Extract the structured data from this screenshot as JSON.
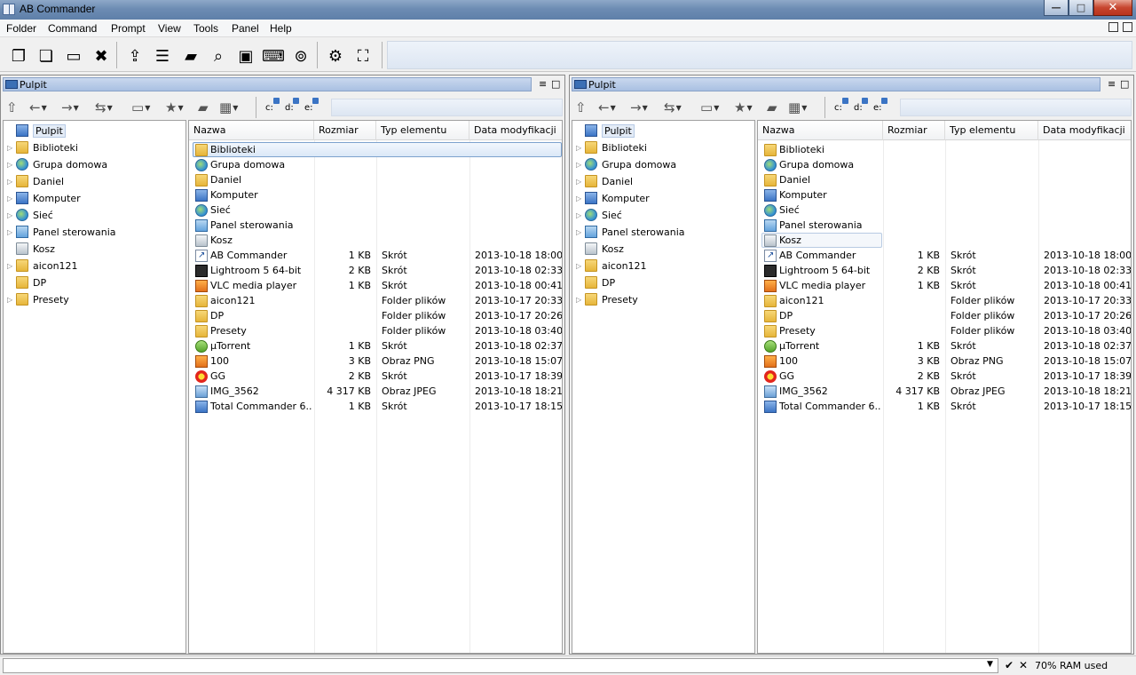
{
  "app": {
    "title": "AB Commander"
  },
  "window_controls": {
    "minimize": "—",
    "maximize": "□",
    "close": "✕"
  },
  "menu": [
    "Folder",
    "Command",
    "Prompt",
    "View",
    "Tools",
    "Panel",
    "Help"
  ],
  "toolbar": {
    "icons": [
      "copy-icon",
      "paste-icon",
      "rename-icon",
      "delete-icon",
      "move-icon",
      "notepad-icon",
      "new-folder-icon",
      "search-icon",
      "image-icon",
      "console-icon",
      "find-icon",
      "settings-icon",
      "fit-icon"
    ],
    "glyphs": [
      "❐",
      "❏",
      "▭",
      "✖",
      "⇪",
      "☰",
      "▰",
      "⌕",
      "▣",
      "⌨",
      "⊚",
      "⚙",
      "⛶"
    ]
  },
  "left_panel": {
    "title": "Pulpit",
    "drives": [
      "c:",
      "d:",
      "e:"
    ],
    "tree": [
      {
        "label": "Pulpit",
        "icon": "desktop-icon",
        "arrow": "",
        "root": true
      },
      {
        "label": "Biblioteki",
        "icon": "libraries-icon",
        "arrow": "▷"
      },
      {
        "label": "Grupa domowa",
        "icon": "homegroup-icon",
        "arrow": "▷"
      },
      {
        "label": "Daniel",
        "icon": "user-folder-icon",
        "arrow": "▷"
      },
      {
        "label": "Komputer",
        "icon": "computer-icon",
        "arrow": "▷"
      },
      {
        "label": "Sieć",
        "icon": "network-icon",
        "arrow": "▷"
      },
      {
        "label": "Panel sterowania",
        "icon": "control-panel-icon",
        "arrow": "▷"
      },
      {
        "label": "Kosz",
        "icon": "recycle-bin-icon",
        "arrow": ""
      },
      {
        "label": "aicon121",
        "icon": "folder-icon",
        "arrow": "▷"
      },
      {
        "label": "DP",
        "icon": "folder-icon",
        "arrow": ""
      },
      {
        "label": "Presety",
        "icon": "folder-icon",
        "arrow": "▷"
      }
    ]
  },
  "right_panel": {
    "title": "Pulpit",
    "drives": [
      "c:",
      "d:",
      "e:"
    ],
    "tree": [
      {
        "label": "Pulpit",
        "icon": "desktop-icon",
        "arrow": "",
        "root": true
      },
      {
        "label": "Biblioteki",
        "icon": "libraries-icon",
        "arrow": "▷"
      },
      {
        "label": "Grupa domowa",
        "icon": "homegroup-icon",
        "arrow": "▷"
      },
      {
        "label": "Daniel",
        "icon": "user-folder-icon",
        "arrow": "▷"
      },
      {
        "label": "Komputer",
        "icon": "computer-icon",
        "arrow": "▷"
      },
      {
        "label": "Sieć",
        "icon": "network-icon",
        "arrow": "▷"
      },
      {
        "label": "Panel sterowania",
        "icon": "control-panel-icon",
        "arrow": "▷"
      },
      {
        "label": "Kosz",
        "icon": "recycle-bin-icon",
        "arrow": ""
      },
      {
        "label": "aicon121",
        "icon": "folder-icon",
        "arrow": "▷"
      },
      {
        "label": "DP",
        "icon": "folder-icon",
        "arrow": ""
      },
      {
        "label": "Presety",
        "icon": "folder-icon",
        "arrow": "▷"
      }
    ]
  },
  "columns": [
    "Nazwa",
    "Rozmiar",
    "Typ elementu",
    "Data modyfikacji"
  ],
  "files": [
    {
      "name": "Biblioteki",
      "size": "",
      "type": "",
      "date": "",
      "icon": "libraries-icon"
    },
    {
      "name": "Grupa domowa",
      "size": "",
      "type": "",
      "date": "",
      "icon": "homegroup-icon"
    },
    {
      "name": "Daniel",
      "size": "",
      "type": "",
      "date": "",
      "icon": "user-folder-icon"
    },
    {
      "name": "Komputer",
      "size": "",
      "type": "",
      "date": "",
      "icon": "computer-icon"
    },
    {
      "name": "Sieć",
      "size": "",
      "type": "",
      "date": "",
      "icon": "network-icon"
    },
    {
      "name": "Panel sterowania",
      "size": "",
      "type": "",
      "date": "",
      "icon": "control-panel-icon"
    },
    {
      "name": "Kosz",
      "size": "",
      "type": "",
      "date": "",
      "icon": "recycle-bin-icon"
    },
    {
      "name": "AB Commander",
      "size": "1 KB",
      "type": "Skrót",
      "date": "2013-10-18 18:00",
      "icon": "shortcut-icon"
    },
    {
      "name": "Lightroom 5 64-bit",
      "size": "2 KB",
      "type": "Skrót",
      "date": "2013-10-18 02:33",
      "icon": "lightroom-icon"
    },
    {
      "name": "VLC media player",
      "size": "1 KB",
      "type": "Skrót",
      "date": "2013-10-18 00:41",
      "icon": "vlc-icon"
    },
    {
      "name": "aicon121",
      "size": "",
      "type": "Folder plików",
      "date": "2013-10-17 20:33",
      "icon": "folder-icon"
    },
    {
      "name": "DP",
      "size": "",
      "type": "Folder plików",
      "date": "2013-10-17 20:26",
      "icon": "folder-icon"
    },
    {
      "name": "Presety",
      "size": "",
      "type": "Folder plików",
      "date": "2013-10-18 03:40",
      "icon": "folder-icon"
    },
    {
      "name": "µTorrent",
      "size": "1 KB",
      "type": "Skrót",
      "date": "2013-10-18 02:37",
      "icon": "utorrent-icon"
    },
    {
      "name": "100",
      "size": "3 KB",
      "type": "Obraz PNG",
      "date": "2013-10-18 15:07",
      "icon": "png-icon"
    },
    {
      "name": "GG",
      "size": "2 KB",
      "type": "Skrót",
      "date": "2013-10-17 18:39",
      "icon": "gg-icon"
    },
    {
      "name": "IMG_3562",
      "size": "4 317 KB",
      "type": "Obraz JPEG",
      "date": "2013-10-18 18:21",
      "icon": "jpeg-icon"
    },
    {
      "name": "Total Commander 6...",
      "size": "1 KB",
      "type": "Skrót",
      "date": "2013-10-17 18:15",
      "icon": "total-commander-icon"
    }
  ],
  "left_selected": "Biblioteki",
  "right_selected": "Kosz",
  "status": {
    "ram": "70% RAM used"
  }
}
